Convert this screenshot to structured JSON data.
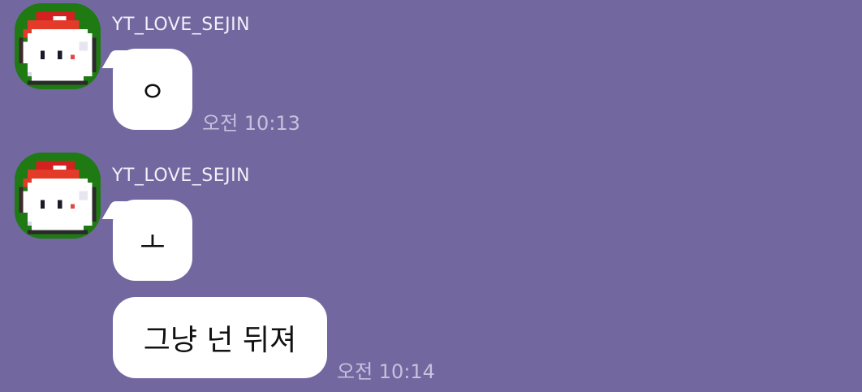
{
  "messages": [
    {
      "sender": "YT_LOVE_SEJIN",
      "avatar_icon": "pixel-ghost-avatar-icon",
      "bubbles": [
        {
          "text": "ㅇ",
          "time": "오전 10:13"
        }
      ]
    },
    {
      "sender": "YT_LOVE_SEJIN",
      "avatar_icon": "pixel-ghost-avatar-icon",
      "bubbles": [
        {
          "text": "ㅗ",
          "time": ""
        },
        {
          "text": "그냥 넌 뒤져",
          "time": "오전 10:14"
        }
      ]
    }
  ],
  "colors": {
    "background": "#7367a0",
    "bubble": "#ffffff",
    "time_text": "#c8c1dd",
    "sender_text": "#f2f0f8"
  }
}
